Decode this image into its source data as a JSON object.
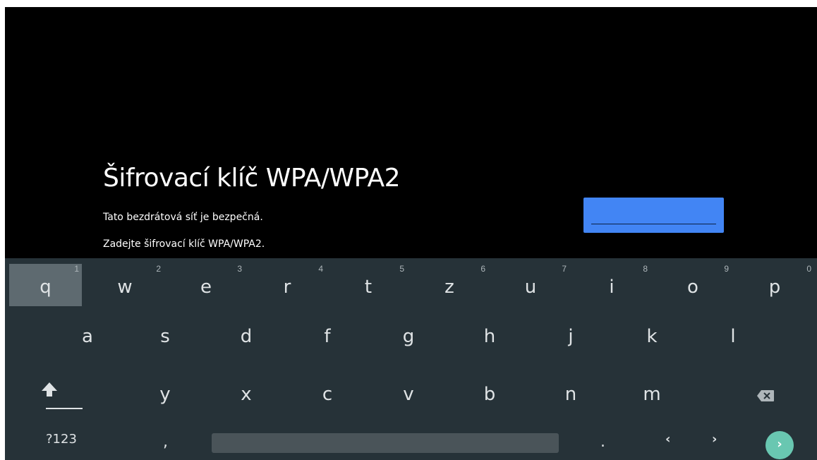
{
  "dialog": {
    "title": "Šifrovací klíč WPA/WPA2",
    "line1": "Tato bezdrátová síť je bezpečná.",
    "line2": "Zadejte šifrovací klíč WPA/WPA2.",
    "password_value": ""
  },
  "keyboard": {
    "row1": [
      {
        "ch": "q",
        "hint": "1"
      },
      {
        "ch": "w",
        "hint": "2"
      },
      {
        "ch": "e",
        "hint": "3"
      },
      {
        "ch": "r",
        "hint": "4"
      },
      {
        "ch": "t",
        "hint": "5"
      },
      {
        "ch": "z",
        "hint": "6"
      },
      {
        "ch": "u",
        "hint": "7"
      },
      {
        "ch": "i",
        "hint": "8"
      },
      {
        "ch": "o",
        "hint": "9"
      },
      {
        "ch": "p",
        "hint": "0"
      }
    ],
    "row2": [
      "a",
      "s",
      "d",
      "f",
      "g",
      "h",
      "j",
      "k",
      "l"
    ],
    "row3": [
      "y",
      "x",
      "c",
      "v",
      "b",
      "n",
      "m"
    ],
    "symbols_label": "?123",
    "comma_label": ",",
    "period_label": ".",
    "left_label": "‹",
    "right_label": "›",
    "enter_label": "›",
    "focused_key": "q"
  },
  "colors": {
    "accent_field": "#4285f4",
    "keyboard_bg": "#263238",
    "enter_button": "#69c7b1"
  }
}
